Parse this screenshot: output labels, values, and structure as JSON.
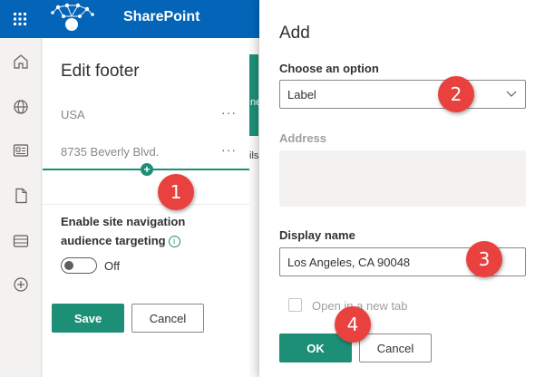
{
  "app": {
    "title": "SharePoint"
  },
  "leftrail": {
    "icons": [
      "home-icon",
      "globe-icon",
      "news-icon",
      "document-icon",
      "list-icon",
      "add-circle-icon"
    ]
  },
  "edit_footer": {
    "title": "Edit footer",
    "items": [
      {
        "label": "USA",
        "more": "···"
      },
      {
        "label": "8735 Beverly Blvd.",
        "more": "···"
      }
    ],
    "add_symbol": "+",
    "navigation_label": "Enable site navigation audience targeting",
    "info_symbol": "i",
    "toggle_state": "Off",
    "save_label": "Save",
    "cancel_label": "Cancel"
  },
  "background": {
    "fragment_1": "ne",
    "fragment_2": "ils"
  },
  "add_dialog": {
    "title": "Add",
    "choose_option_label": "Choose an option",
    "choose_option_value": "Label",
    "address_label": "Address",
    "address_value": "",
    "display_name_label": "Display name",
    "display_name_value": "Los Angeles, CA 90048",
    "new_tab_label": "Open in a new tab",
    "ok_label": "OK",
    "cancel_label": "Cancel"
  },
  "markers": [
    "1",
    "2",
    "3",
    "4"
  ],
  "colors": {
    "suitebar": "#0364b8",
    "accent": "#1d8f76",
    "marker": "#e8413e"
  }
}
